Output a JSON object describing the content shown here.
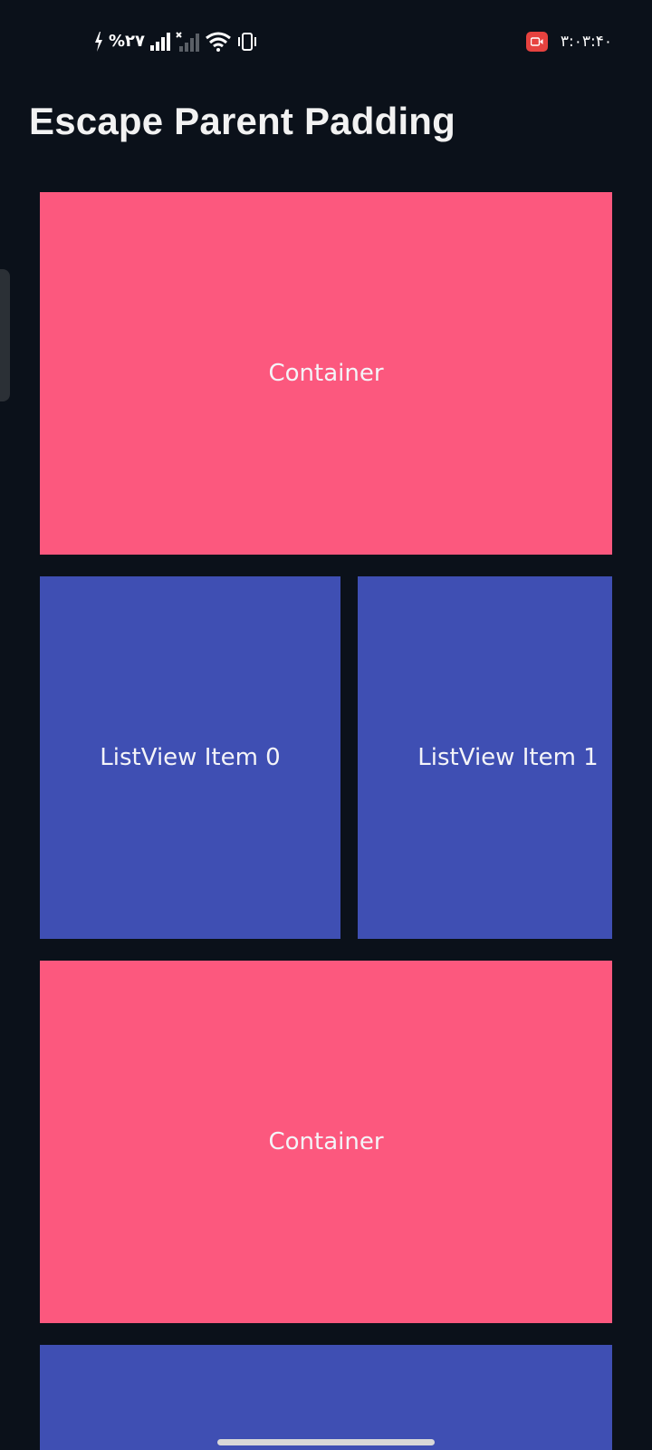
{
  "status_bar": {
    "battery_text": "%۲۷",
    "time": "۳:۰۳:۴۰",
    "icons": [
      "charging-bolt-icon",
      "signal-icon",
      "signal-no-service-icon",
      "wifi-icon",
      "vibrate-icon",
      "screen-record-icon"
    ],
    "record_color": "#e6423f"
  },
  "page": {
    "title": "Escape Parent Padding"
  },
  "content": {
    "container_top_label": "Container",
    "list_items": [
      {
        "label": "ListView Item 0"
      },
      {
        "label": "ListView Item 1"
      }
    ],
    "container_bottom_label": "Container"
  },
  "colors": {
    "background": "#0b111a",
    "container": "#fc587e",
    "list_item": "#3f4fb3"
  }
}
